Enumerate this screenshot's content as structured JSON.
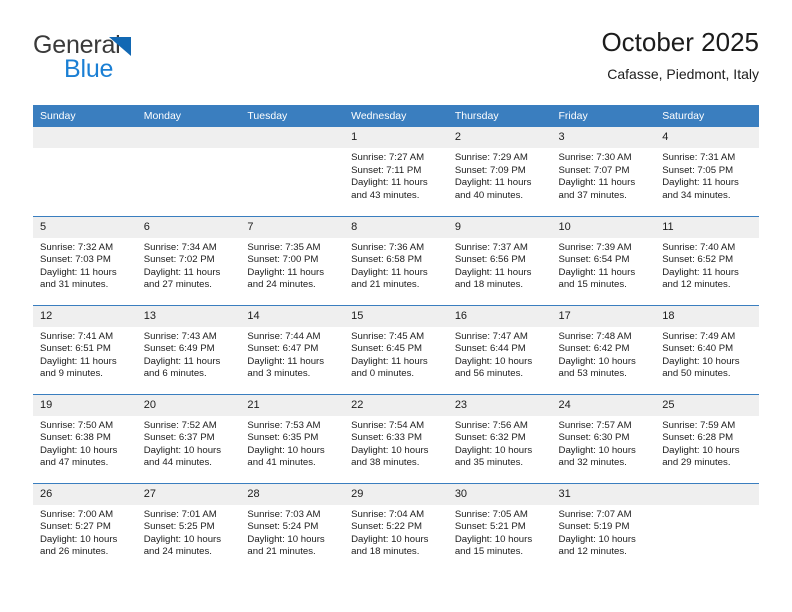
{
  "brand": {
    "name_part1": "General",
    "name_part2": "Blue",
    "triangle_color": "#1268b3",
    "blue_color": "#1a7fd4"
  },
  "header": {
    "title": "October 2025",
    "subtitle": "Cafasse, Piedmont, Italy"
  },
  "theme": {
    "header_bar_color": "#3a7ebf",
    "date_band_color": "#efefef",
    "text_color": "#1c1c1c"
  },
  "weekday_headers": [
    "Sunday",
    "Monday",
    "Tuesday",
    "Wednesday",
    "Thursday",
    "Friday",
    "Saturday"
  ],
  "weeks": [
    [
      {
        "day": "",
        "sunrise": "",
        "sunset": "",
        "daylight_line1": "",
        "daylight_line2": ""
      },
      {
        "day": "",
        "sunrise": "",
        "sunset": "",
        "daylight_line1": "",
        "daylight_line2": ""
      },
      {
        "day": "",
        "sunrise": "",
        "sunset": "",
        "daylight_line1": "",
        "daylight_line2": ""
      },
      {
        "day": "1",
        "sunrise": "Sunrise: 7:27 AM",
        "sunset": "Sunset: 7:11 PM",
        "daylight_line1": "Daylight: 11 hours",
        "daylight_line2": "and 43 minutes."
      },
      {
        "day": "2",
        "sunrise": "Sunrise: 7:29 AM",
        "sunset": "Sunset: 7:09 PM",
        "daylight_line1": "Daylight: 11 hours",
        "daylight_line2": "and 40 minutes."
      },
      {
        "day": "3",
        "sunrise": "Sunrise: 7:30 AM",
        "sunset": "Sunset: 7:07 PM",
        "daylight_line1": "Daylight: 11 hours",
        "daylight_line2": "and 37 minutes."
      },
      {
        "day": "4",
        "sunrise": "Sunrise: 7:31 AM",
        "sunset": "Sunset: 7:05 PM",
        "daylight_line1": "Daylight: 11 hours",
        "daylight_line2": "and 34 minutes."
      }
    ],
    [
      {
        "day": "5",
        "sunrise": "Sunrise: 7:32 AM",
        "sunset": "Sunset: 7:03 PM",
        "daylight_line1": "Daylight: 11 hours",
        "daylight_line2": "and 31 minutes."
      },
      {
        "day": "6",
        "sunrise": "Sunrise: 7:34 AM",
        "sunset": "Sunset: 7:02 PM",
        "daylight_line1": "Daylight: 11 hours",
        "daylight_line2": "and 27 minutes."
      },
      {
        "day": "7",
        "sunrise": "Sunrise: 7:35 AM",
        "sunset": "Sunset: 7:00 PM",
        "daylight_line1": "Daylight: 11 hours",
        "daylight_line2": "and 24 minutes."
      },
      {
        "day": "8",
        "sunrise": "Sunrise: 7:36 AM",
        "sunset": "Sunset: 6:58 PM",
        "daylight_line1": "Daylight: 11 hours",
        "daylight_line2": "and 21 minutes."
      },
      {
        "day": "9",
        "sunrise": "Sunrise: 7:37 AM",
        "sunset": "Sunset: 6:56 PM",
        "daylight_line1": "Daylight: 11 hours",
        "daylight_line2": "and 18 minutes."
      },
      {
        "day": "10",
        "sunrise": "Sunrise: 7:39 AM",
        "sunset": "Sunset: 6:54 PM",
        "daylight_line1": "Daylight: 11 hours",
        "daylight_line2": "and 15 minutes."
      },
      {
        "day": "11",
        "sunrise": "Sunrise: 7:40 AM",
        "sunset": "Sunset: 6:52 PM",
        "daylight_line1": "Daylight: 11 hours",
        "daylight_line2": "and 12 minutes."
      }
    ],
    [
      {
        "day": "12",
        "sunrise": "Sunrise: 7:41 AM",
        "sunset": "Sunset: 6:51 PM",
        "daylight_line1": "Daylight: 11 hours",
        "daylight_line2": "and 9 minutes."
      },
      {
        "day": "13",
        "sunrise": "Sunrise: 7:43 AM",
        "sunset": "Sunset: 6:49 PM",
        "daylight_line1": "Daylight: 11 hours",
        "daylight_line2": "and 6 minutes."
      },
      {
        "day": "14",
        "sunrise": "Sunrise: 7:44 AM",
        "sunset": "Sunset: 6:47 PM",
        "daylight_line1": "Daylight: 11 hours",
        "daylight_line2": "and 3 minutes."
      },
      {
        "day": "15",
        "sunrise": "Sunrise: 7:45 AM",
        "sunset": "Sunset: 6:45 PM",
        "daylight_line1": "Daylight: 11 hours",
        "daylight_line2": "and 0 minutes."
      },
      {
        "day": "16",
        "sunrise": "Sunrise: 7:47 AM",
        "sunset": "Sunset: 6:44 PM",
        "daylight_line1": "Daylight: 10 hours",
        "daylight_line2": "and 56 minutes."
      },
      {
        "day": "17",
        "sunrise": "Sunrise: 7:48 AM",
        "sunset": "Sunset: 6:42 PM",
        "daylight_line1": "Daylight: 10 hours",
        "daylight_line2": "and 53 minutes."
      },
      {
        "day": "18",
        "sunrise": "Sunrise: 7:49 AM",
        "sunset": "Sunset: 6:40 PM",
        "daylight_line1": "Daylight: 10 hours",
        "daylight_line2": "and 50 minutes."
      }
    ],
    [
      {
        "day": "19",
        "sunrise": "Sunrise: 7:50 AM",
        "sunset": "Sunset: 6:38 PM",
        "daylight_line1": "Daylight: 10 hours",
        "daylight_line2": "and 47 minutes."
      },
      {
        "day": "20",
        "sunrise": "Sunrise: 7:52 AM",
        "sunset": "Sunset: 6:37 PM",
        "daylight_line1": "Daylight: 10 hours",
        "daylight_line2": "and 44 minutes."
      },
      {
        "day": "21",
        "sunrise": "Sunrise: 7:53 AM",
        "sunset": "Sunset: 6:35 PM",
        "daylight_line1": "Daylight: 10 hours",
        "daylight_line2": "and 41 minutes."
      },
      {
        "day": "22",
        "sunrise": "Sunrise: 7:54 AM",
        "sunset": "Sunset: 6:33 PM",
        "daylight_line1": "Daylight: 10 hours",
        "daylight_line2": "and 38 minutes."
      },
      {
        "day": "23",
        "sunrise": "Sunrise: 7:56 AM",
        "sunset": "Sunset: 6:32 PM",
        "daylight_line1": "Daylight: 10 hours",
        "daylight_line2": "and 35 minutes."
      },
      {
        "day": "24",
        "sunrise": "Sunrise: 7:57 AM",
        "sunset": "Sunset: 6:30 PM",
        "daylight_line1": "Daylight: 10 hours",
        "daylight_line2": "and 32 minutes."
      },
      {
        "day": "25",
        "sunrise": "Sunrise: 7:59 AM",
        "sunset": "Sunset: 6:28 PM",
        "daylight_line1": "Daylight: 10 hours",
        "daylight_line2": "and 29 minutes."
      }
    ],
    [
      {
        "day": "26",
        "sunrise": "Sunrise: 7:00 AM",
        "sunset": "Sunset: 5:27 PM",
        "daylight_line1": "Daylight: 10 hours",
        "daylight_line2": "and 26 minutes."
      },
      {
        "day": "27",
        "sunrise": "Sunrise: 7:01 AM",
        "sunset": "Sunset: 5:25 PM",
        "daylight_line1": "Daylight: 10 hours",
        "daylight_line2": "and 24 minutes."
      },
      {
        "day": "28",
        "sunrise": "Sunrise: 7:03 AM",
        "sunset": "Sunset: 5:24 PM",
        "daylight_line1": "Daylight: 10 hours",
        "daylight_line2": "and 21 minutes."
      },
      {
        "day": "29",
        "sunrise": "Sunrise: 7:04 AM",
        "sunset": "Sunset: 5:22 PM",
        "daylight_line1": "Daylight: 10 hours",
        "daylight_line2": "and 18 minutes."
      },
      {
        "day": "30",
        "sunrise": "Sunrise: 7:05 AM",
        "sunset": "Sunset: 5:21 PM",
        "daylight_line1": "Daylight: 10 hours",
        "daylight_line2": "and 15 minutes."
      },
      {
        "day": "31",
        "sunrise": "Sunrise: 7:07 AM",
        "sunset": "Sunset: 5:19 PM",
        "daylight_line1": "Daylight: 10 hours",
        "daylight_line2": "and 12 minutes."
      },
      {
        "day": "",
        "sunrise": "",
        "sunset": "",
        "daylight_line1": "",
        "daylight_line2": ""
      }
    ]
  ]
}
